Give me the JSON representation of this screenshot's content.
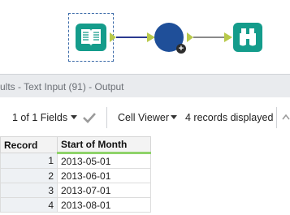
{
  "results": {
    "title": "ults - Text Input (91) - Output"
  },
  "toolbar": {
    "fields_label": "1 of 1 Fields",
    "viewer_label": "Cell Viewer",
    "records_label": "4 records displayed"
  },
  "grid": {
    "columns": [
      "Record",
      "Start of Month"
    ],
    "rows": [
      {
        "record": "1",
        "value": "2013-05-01"
      },
      {
        "record": "2",
        "value": "2013-06-01"
      },
      {
        "record": "3",
        "value": "2013-07-01"
      },
      {
        "record": "4",
        "value": "2013-08-01"
      }
    ]
  },
  "colors": {
    "tool_teal": "#149c8b",
    "tool_navy": "#1f4f99",
    "anchor_green": "#b8c94a",
    "header_underline": "#8fd36a"
  },
  "icons": {
    "input_tool": "book-icon",
    "formula_tool": "formula-icon",
    "browse_tool": "binoculars-icon"
  }
}
